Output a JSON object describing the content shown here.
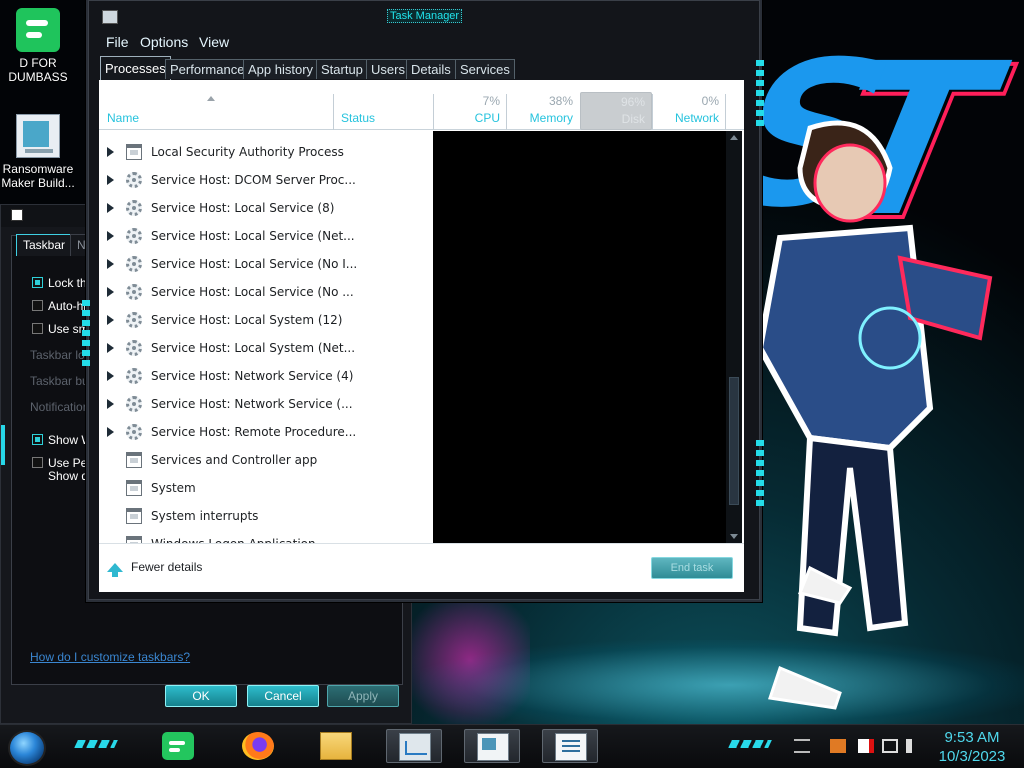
{
  "desktop": {
    "icons": [
      {
        "label": "D FOR DUMBASS"
      },
      {
        "label": "Ransomware Maker Build..."
      }
    ]
  },
  "taskbar_properties": {
    "tabs": [
      "Taskbar",
      "Na"
    ],
    "checkboxes": [
      {
        "label": "Lock the",
        "checked": true
      },
      {
        "label": "Auto-hid",
        "checked": false
      },
      {
        "label": "Use sma",
        "checked": false
      }
    ],
    "labels": [
      "Taskbar lo",
      "Taskbar bu",
      "Notification"
    ],
    "checkboxes2": [
      {
        "label": "Show W",
        "checked": true
      },
      {
        "label": "Use Pee",
        "checked": false
      }
    ],
    "extra_label": "Show de",
    "help_link": "How do I customize taskbars?",
    "buttons": {
      "ok": "OK",
      "cancel": "Cancel",
      "apply": "Apply"
    }
  },
  "task_manager": {
    "title": "Task Manager",
    "menu": [
      "File",
      "Options",
      "View"
    ],
    "tabs": [
      "Processes",
      "Performance",
      "App history",
      "Startup",
      "Users",
      "Details",
      "Services"
    ],
    "active_tab": "Processes",
    "columns": {
      "name": "Name",
      "status": "Status",
      "cpu": {
        "label": "CPU",
        "pct": "7%"
      },
      "memory": {
        "label": "Memory",
        "pct": "38%"
      },
      "disk": {
        "label": "Disk",
        "pct": "96%"
      },
      "network": {
        "label": "Network",
        "pct": "0%"
      }
    },
    "processes": [
      {
        "name": "Local Security Authority Process",
        "icon": "window-icon",
        "expandable": true
      },
      {
        "name": "Service Host: DCOM Server Proc...",
        "icon": "gear-icon",
        "expandable": true
      },
      {
        "name": "Service Host: Local Service (8)",
        "icon": "gear-icon",
        "expandable": true
      },
      {
        "name": "Service Host: Local Service (Net...",
        "icon": "gear-icon",
        "expandable": true
      },
      {
        "name": "Service Host: Local Service (No I...",
        "icon": "gear-icon",
        "expandable": true
      },
      {
        "name": "Service Host: Local Service (No ...",
        "icon": "gear-icon",
        "expandable": true
      },
      {
        "name": "Service Host: Local System (12)",
        "icon": "gear-icon",
        "expandable": true
      },
      {
        "name": "Service Host: Local System (Net...",
        "icon": "gear-icon",
        "expandable": true
      },
      {
        "name": "Service Host: Network Service (4)",
        "icon": "gear-icon",
        "expandable": true
      },
      {
        "name": "Service Host: Network Service (...",
        "icon": "gear-icon",
        "expandable": true
      },
      {
        "name": "Service Host: Remote Procedure...",
        "icon": "gear-icon",
        "expandable": true
      },
      {
        "name": "Services and Controller app",
        "icon": "window-icon",
        "expandable": false
      },
      {
        "name": "System",
        "icon": "window-icon",
        "expandable": false
      },
      {
        "name": "System interrupts",
        "icon": "window-icon",
        "expandable": false
      },
      {
        "name": "Windows Logon Application",
        "icon": "window-icon",
        "expandable": false
      }
    ],
    "footer": {
      "fewer_details": "Fewer details",
      "end_task": "End task"
    }
  },
  "taskbar": {
    "pinned": [
      "app-green-icon",
      "firefox-icon",
      "file-explorer-icon",
      "task-manager-icon",
      "screenshot-icon",
      "checklist-icon"
    ],
    "clock_time": "9:53 AM",
    "clock_date": "10/3/2023"
  },
  "colors": {
    "accent": "#22d6e6",
    "brand_pink": "#ff1f5a",
    "wallpaper_blue": "#1b98ee"
  }
}
